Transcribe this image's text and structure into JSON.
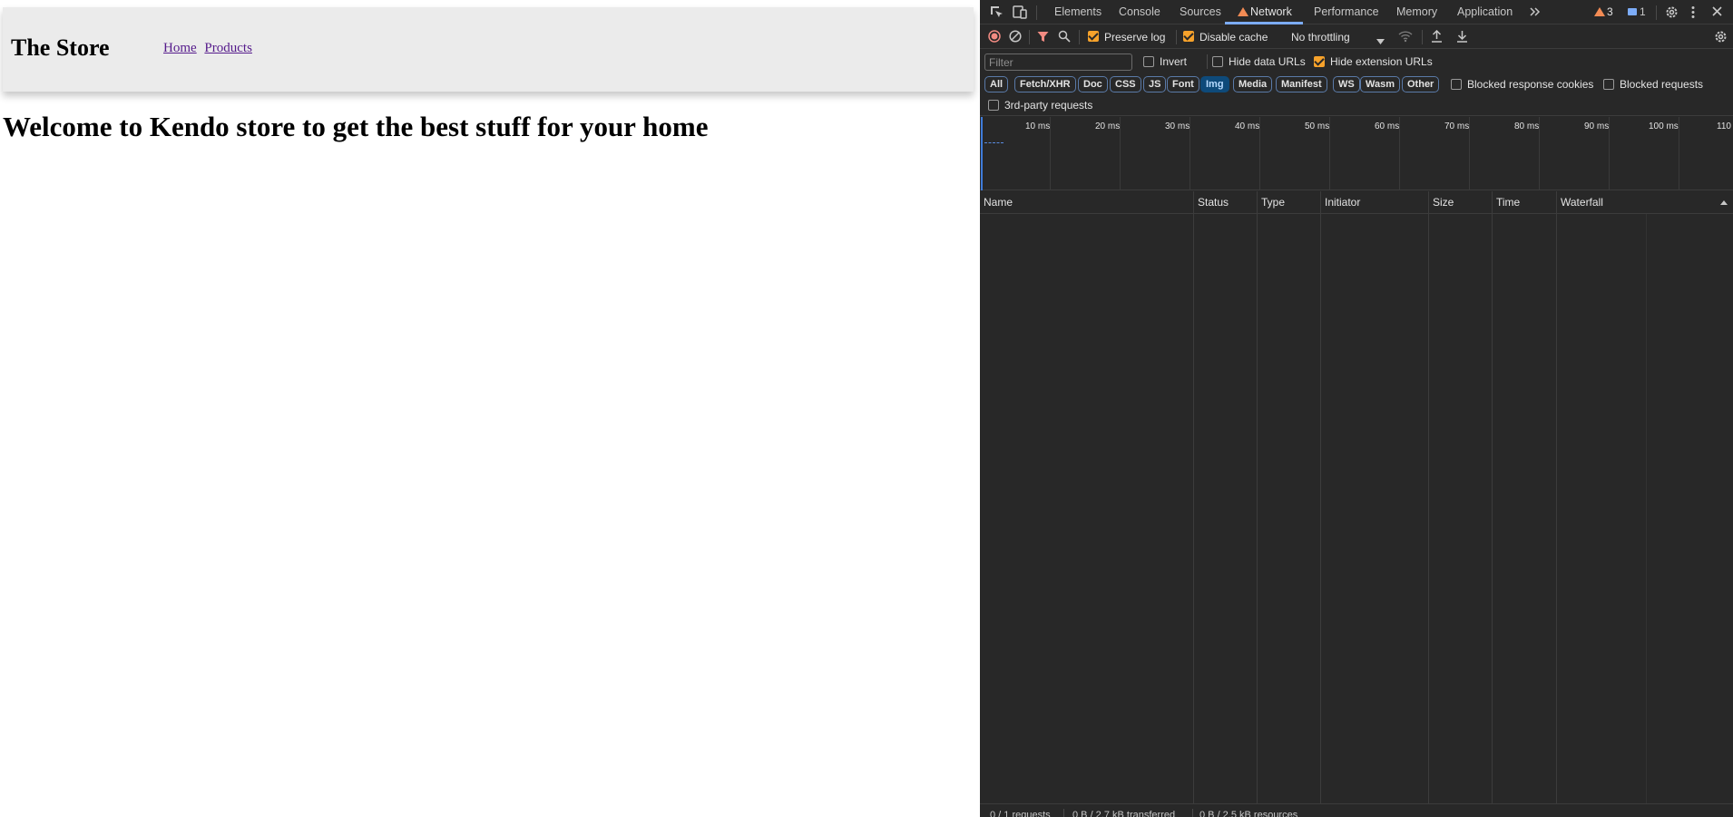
{
  "page": {
    "site_title": "The Store",
    "nav": [
      "Home",
      "Products"
    ],
    "welcome": "Welcome to Kendo store to get the best stuff for your home"
  },
  "devtools": {
    "tabs": [
      "Elements",
      "Console",
      "Sources",
      "Network",
      "Performance",
      "Memory",
      "Application"
    ],
    "active_tab": "Network",
    "warning_count": "3",
    "message_count": "1",
    "toolbar": {
      "preserve_log": "Preserve log",
      "disable_cache": "Disable cache",
      "throttling": "No throttling"
    },
    "filter": {
      "placeholder": "Filter",
      "invert": "Invert",
      "hide_data_urls": "Hide data URLs",
      "hide_extension_urls": "Hide extension URLs"
    },
    "types": [
      "All",
      "Fetch/XHR",
      "Doc",
      "CSS",
      "JS",
      "Font",
      "Img",
      "Media",
      "Manifest",
      "WS",
      "Wasm",
      "Other"
    ],
    "active_type": "Img",
    "blocked_response_cookies": "Blocked response cookies",
    "blocked_requests": "Blocked requests",
    "third_party": "3rd-party requests",
    "timeline_ticks": [
      "10 ms",
      "20 ms",
      "30 ms",
      "40 ms",
      "50 ms",
      "60 ms",
      "70 ms",
      "80 ms",
      "90 ms",
      "100 ms",
      "110"
    ],
    "columns": [
      "Name",
      "Status",
      "Type",
      "Initiator",
      "Size",
      "Time",
      "Waterfall"
    ],
    "status": {
      "requests": "0 / 1 requests",
      "transferred": "0 B / 2.7 kB transferred",
      "resources": "0 B / 2.5 kB resources"
    }
  }
}
